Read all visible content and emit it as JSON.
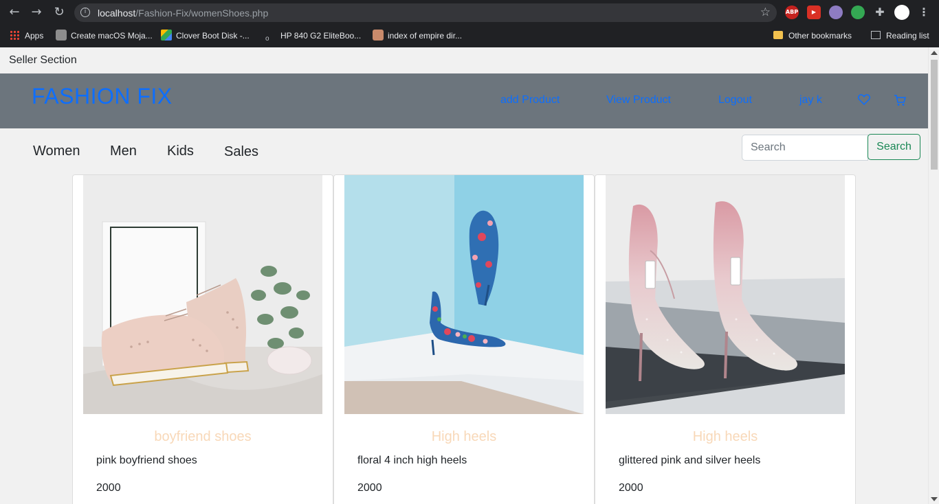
{
  "browser": {
    "url_host": "localhost",
    "url_path": "/Fashion-Fix/womenShoes.php",
    "extensions": [
      "ABP"
    ],
    "bookmarks": [
      {
        "label": "Apps"
      },
      {
        "label": "Create macOS Moja..."
      },
      {
        "label": "Clover Boot Disk -..."
      },
      {
        "label": "HP 840 G2 EliteBoo..."
      },
      {
        "label": "index of empire dir..."
      },
      {
        "label": "Other bookmarks"
      },
      {
        "label": "Reading list"
      }
    ]
  },
  "seller_section": "Seller Section",
  "header": {
    "brand": "FASHION FIX",
    "links": [
      "add Product",
      "View Product",
      "Logout",
      "jay k"
    ],
    "accent": "#0d6efd",
    "bg": "#6c757d"
  },
  "categories": [
    "Women",
    "Men",
    "Kids",
    "Sales"
  ],
  "search": {
    "placeholder": "Search",
    "button": "Search"
  },
  "products": [
    {
      "title": "boyfriend shoes",
      "description": "pink boyfriend shoes",
      "price": "2000"
    },
    {
      "title": "High heels",
      "description": "floral 4 inch high heels",
      "price": "2000"
    },
    {
      "title": "High heels",
      "description": "glittered pink and silver heels",
      "price": "2000"
    }
  ]
}
